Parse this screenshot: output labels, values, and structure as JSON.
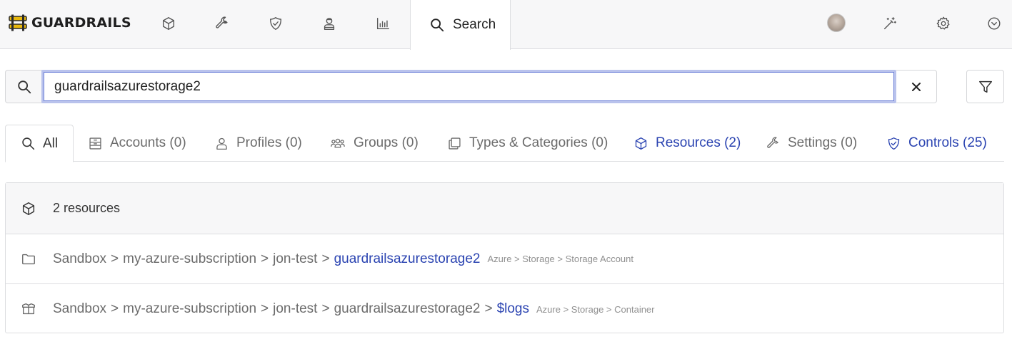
{
  "app": {
    "brand": "GUARDRAILS",
    "brand_color": "#e8b80d"
  },
  "topnav": {
    "icons": [
      "cube-icon",
      "wrench-icon",
      "shield-check-icon",
      "person-icon",
      "bar-chart-icon"
    ],
    "search_tab_label": "Search",
    "right_icons": [
      "avatar",
      "magic-wand-icon",
      "gear-icon",
      "chevron-down-circle-icon"
    ]
  },
  "search": {
    "value": "guardrailsazurestorage2",
    "clear_icon": "close-icon",
    "filter_icon": "filter-icon"
  },
  "tabs": [
    {
      "label": "All",
      "icon": "search-icon",
      "active": true
    },
    {
      "label": "Accounts (0)",
      "icon": "account-icon"
    },
    {
      "label": "Profiles (0)",
      "icon": "profile-icon"
    },
    {
      "label": "Groups (0)",
      "icon": "groups-icon"
    },
    {
      "label": "Types & Categories (0)",
      "icon": "types-icon"
    },
    {
      "label": "Resources (2)",
      "icon": "cube-icon",
      "color": "#2a43b1"
    },
    {
      "label": "Settings (0)",
      "icon": "wrench-icon"
    },
    {
      "label": "Controls (25)",
      "icon": "shield-check-icon",
      "color": "#2a43b1"
    }
  ],
  "results": {
    "header": "2 resources",
    "separator": ">",
    "rows": [
      {
        "icon": "folder-icon",
        "path": [
          "Sandbox",
          "my-azure-subscription",
          "jon-test"
        ],
        "link": "guardrailsazurestorage2",
        "type": "Azure > Storage > Storage Account"
      },
      {
        "icon": "container-icon",
        "path": [
          "Sandbox",
          "my-azure-subscription",
          "jon-test",
          "guardrailsazurestorage2"
        ],
        "link": "$logs",
        "type": "Azure > Storage > Container"
      }
    ]
  }
}
